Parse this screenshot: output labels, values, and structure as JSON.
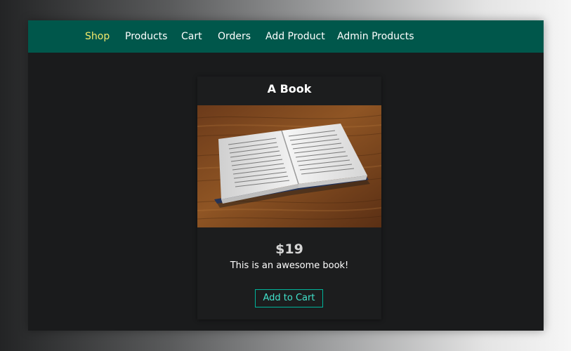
{
  "nav": {
    "items": [
      {
        "label": "Shop",
        "active": true
      },
      {
        "label": "Products",
        "active": false
      },
      {
        "label": "Cart",
        "active": false
      },
      {
        "label": "Orders",
        "active": false
      },
      {
        "label": "Add Product",
        "active": false
      },
      {
        "label": "Admin Products",
        "active": false
      }
    ]
  },
  "product": {
    "title": "A Book",
    "image": "open-book-photo",
    "price": "$19",
    "description": "This is an awesome book!",
    "button_label": "Add to Cart"
  },
  "colors": {
    "navbar": "#00574b",
    "nav_active": "#f3e96b",
    "page_background": "#1a1b1c",
    "button_border": "#00b39b",
    "button_text": "#41e3cc"
  }
}
